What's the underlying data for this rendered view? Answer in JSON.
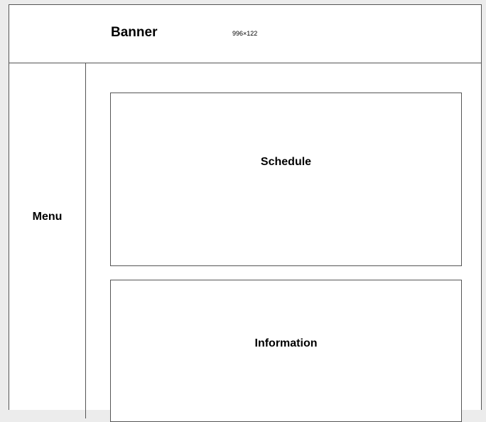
{
  "banner": {
    "title": "Banner",
    "size_note": "996×122"
  },
  "menu": {
    "label": "Menu"
  },
  "sections": {
    "schedule": "Schedule",
    "information": "Information"
  }
}
